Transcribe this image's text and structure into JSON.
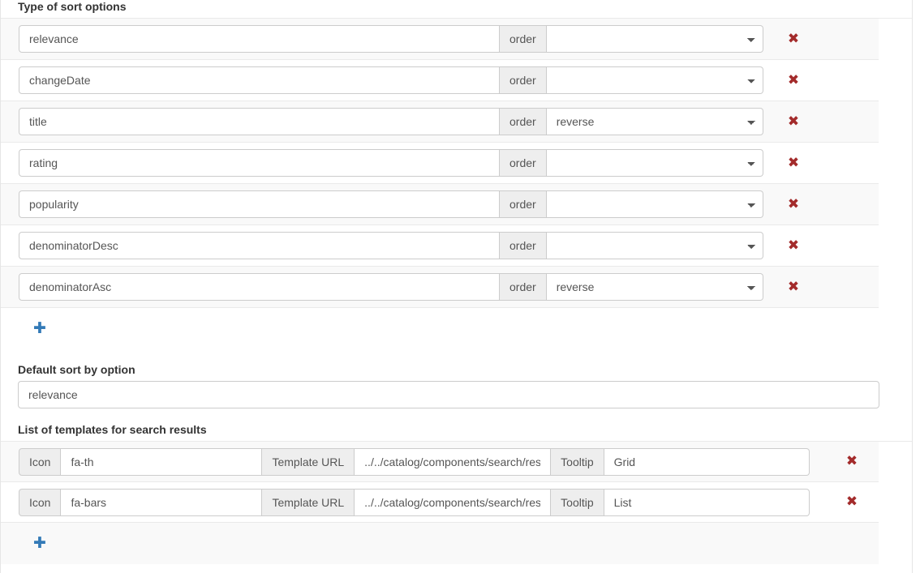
{
  "sort_section": {
    "label": "Type of sort options",
    "order_addon": "order",
    "remove_icon": "✖",
    "add_icon": "✚",
    "order_options": [
      "",
      "reverse"
    ],
    "rows": [
      {
        "name": "relevance",
        "order": ""
      },
      {
        "name": "changeDate",
        "order": ""
      },
      {
        "name": "title",
        "order": "reverse"
      },
      {
        "name": "rating",
        "order": ""
      },
      {
        "name": "popularity",
        "order": ""
      },
      {
        "name": "denominatorDesc",
        "order": ""
      },
      {
        "name": "denominatorAsc",
        "order": "reverse"
      }
    ]
  },
  "default_sort": {
    "label": "Default sort by option",
    "value": "relevance"
  },
  "templates_section": {
    "label": "List of templates for search results",
    "icon_addon": "Icon",
    "url_addon": "Template URL",
    "tooltip_addon": "Tooltip",
    "remove_icon": "✖",
    "add_icon": "✚",
    "rows": [
      {
        "icon": "fa-th",
        "url": "../../catalog/components/search/resu",
        "tooltip": "Grid"
      },
      {
        "icon": "fa-bars",
        "url": "../../catalog/components/search/resu",
        "tooltip": "List"
      }
    ]
  },
  "colors": {
    "remove": "#a32b2b",
    "add": "#337ab7",
    "stripe": "#f9f9f9",
    "border": "#cccccc"
  }
}
